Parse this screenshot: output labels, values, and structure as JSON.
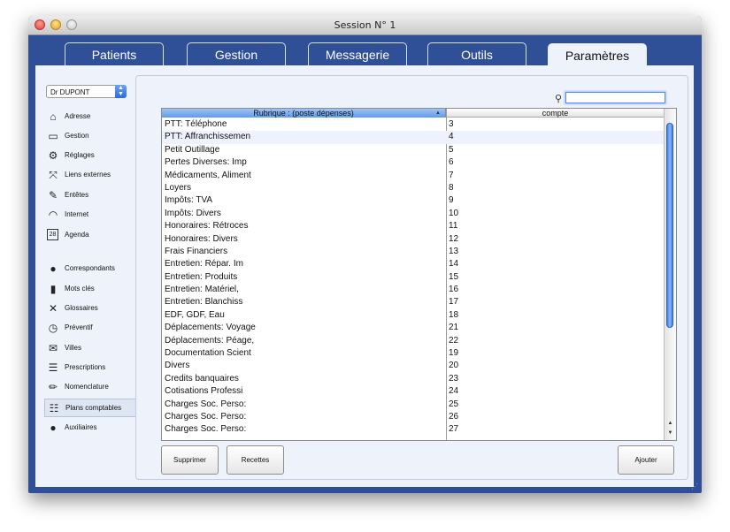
{
  "window": {
    "title": "Session N° 1"
  },
  "tabs": [
    {
      "label": "Patients"
    },
    {
      "label": "Gestion"
    },
    {
      "label": "Messagerie"
    },
    {
      "label": "Outils"
    },
    {
      "label": "Paramètres",
      "active": true
    }
  ],
  "doctor_select": {
    "value": "Dr DUPONT"
  },
  "sidebar": {
    "items": [
      {
        "label": "Adresse",
        "icon": "house-icon"
      },
      {
        "label": "Gestion",
        "icon": "tray-icon"
      },
      {
        "label": "Réglages",
        "icon": "gear-icon"
      },
      {
        "label": "Liens externes",
        "icon": "expand-arrows-icon"
      },
      {
        "label": "Entêtes",
        "icon": "edit-icon"
      },
      {
        "label": "Internet",
        "icon": "wifi-icon"
      },
      {
        "label": "Agenda",
        "icon": "calendar-icon",
        "badge": "28"
      },
      {
        "label": "Correspondants",
        "icon": "person-icon"
      },
      {
        "label": "Mots clés",
        "icon": "bar-chart-icon"
      },
      {
        "label": "Glossaires",
        "icon": "tools-icon"
      },
      {
        "label": "Préventif",
        "icon": "clock-icon"
      },
      {
        "label": "Villes",
        "icon": "envelope-icon"
      },
      {
        "label": "Prescriptions",
        "icon": "list-icon"
      },
      {
        "label": "Nomenclature",
        "icon": "pencil-icon"
      },
      {
        "label": "Plans comptables",
        "icon": "list-lines-icon",
        "active": true
      },
      {
        "label": "Auxiliaires",
        "icon": "people-icon"
      }
    ]
  },
  "search": {
    "value": "",
    "placeholder": ""
  },
  "table": {
    "columns": [
      "Rubrique : (poste dépenses)",
      "compte"
    ],
    "rows": [
      {
        "rubrique": "PTT: Téléphone",
        "compte": "3"
      },
      {
        "rubrique": "PTT: Affranchissemen",
        "compte": "4"
      },
      {
        "rubrique": "Petit Outillage",
        "compte": "5"
      },
      {
        "rubrique": "Pertes Diverses: Imp",
        "compte": "6"
      },
      {
        "rubrique": "Médicaments, Aliment",
        "compte": "7"
      },
      {
        "rubrique": "Loyers",
        "compte": "8"
      },
      {
        "rubrique": "Impôts: TVA",
        "compte": "9"
      },
      {
        "rubrique": "Impôts: Divers",
        "compte": "10"
      },
      {
        "rubrique": "Honoraires: Rétroces",
        "compte": "11"
      },
      {
        "rubrique": "Honoraires: Divers",
        "compte": "12"
      },
      {
        "rubrique": "Frais Financiers",
        "compte": "13"
      },
      {
        "rubrique": "Entretien: Répar. Im",
        "compte": "14"
      },
      {
        "rubrique": "Entretien: Produits",
        "compte": "15"
      },
      {
        "rubrique": "Entretien: Matériel,",
        "compte": "16"
      },
      {
        "rubrique": "Entretien: Blanchiss",
        "compte": "17"
      },
      {
        "rubrique": "EDF, GDF, Eau",
        "compte": "18"
      },
      {
        "rubrique": "Déplacements: Voyage",
        "compte": "21"
      },
      {
        "rubrique": "Déplacements: Péage,",
        "compte": "22"
      },
      {
        "rubrique": "Documentation Scient",
        "compte": "19"
      },
      {
        "rubrique": "Divers",
        "compte": "20"
      },
      {
        "rubrique": "Credits banquaires",
        "compte": "23"
      },
      {
        "rubrique": "Cotisations Professi",
        "compte": "24"
      },
      {
        "rubrique": "Charges Soc. Perso:",
        "compte": "25"
      },
      {
        "rubrique": "Charges Soc. Perso:",
        "compte": "26"
      },
      {
        "rubrique": "Charges Soc. Perso:",
        "compte": "27"
      }
    ]
  },
  "buttons": {
    "delete": "Supprimer",
    "receipts": "Recettes",
    "add": "Ajouter"
  },
  "colors": {
    "window_bg": "#2f4f96",
    "content_bg": "#eef2fb",
    "header_sorted": "#6fa6ec",
    "accent": "#3c7be8"
  }
}
